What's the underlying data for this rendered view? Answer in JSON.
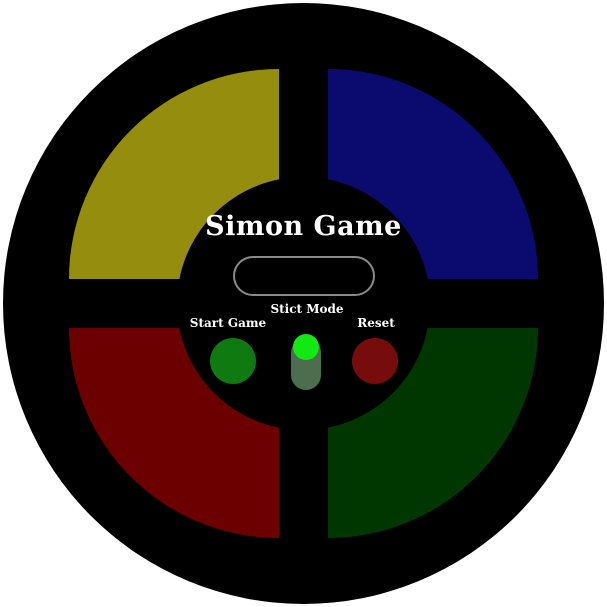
{
  "game": {
    "title": "Simon Game",
    "count_display": ""
  },
  "pads": {
    "yellow_color": "#948d0d",
    "blue_color": "#0b0a6e",
    "red_color": "#6c0000",
    "green_color": "#003600"
  },
  "controls": {
    "start_label": "Start Game",
    "strict_label": "Stict Mode",
    "reset_label": "Reset",
    "start_color": "#0f7a0f",
    "reset_color": "#760c0c",
    "strict_track_color": "#4c6e4f",
    "strict_knob_color": "#12e812",
    "strict_on": true
  },
  "colors": {
    "board": "#000000",
    "display_border": "#8a8a8a",
    "text": "#ffffff"
  }
}
